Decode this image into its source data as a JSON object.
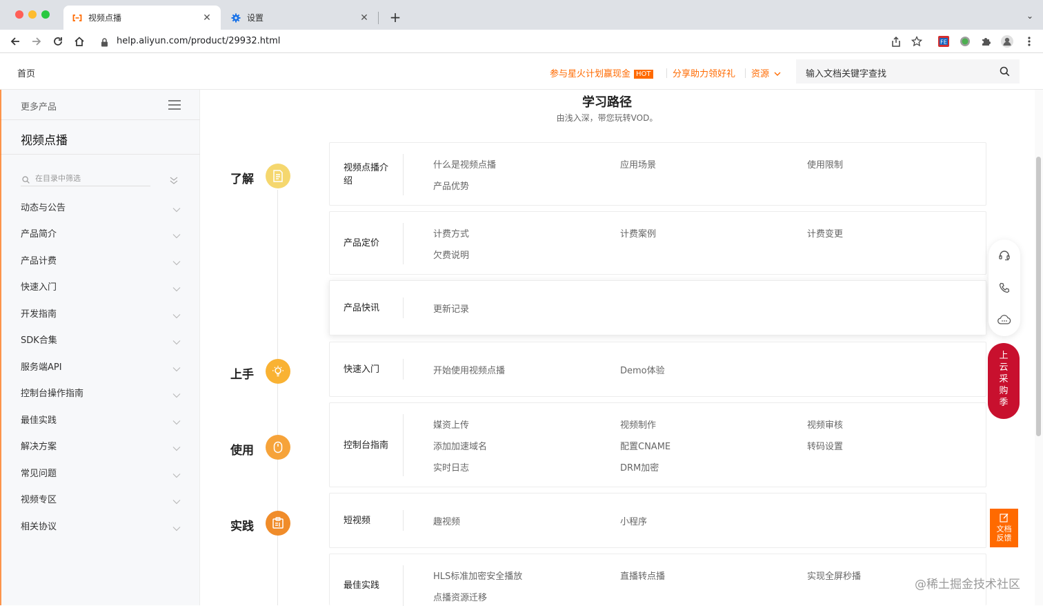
{
  "browser": {
    "tabs": [
      {
        "title": "视频点播",
        "icon": "aliyun-logo-icon",
        "active": true
      },
      {
        "title": "设置",
        "icon": "gear-icon",
        "active": false
      }
    ],
    "url": "help.aliyun.com/product/29932.html",
    "new_tab_symbol": "+",
    "tab_close_symbol": "✕",
    "tab_menu_symbol": "⌄"
  },
  "header": {
    "home_label": "首页",
    "promo1": "参与星火计划赢现金",
    "promo1_badge": "HOT",
    "promo2": "分享助力领好礼",
    "resources_label": "资源",
    "search_placeholder": "输入文档关键字查找"
  },
  "sidebar": {
    "more_products": "更多产品",
    "product_title": "视频点播",
    "filter_placeholder": "在目录中筛选",
    "items": [
      {
        "label": "动态与公告"
      },
      {
        "label": "产品简介"
      },
      {
        "label": "产品计费"
      },
      {
        "label": "快速入门"
      },
      {
        "label": "开发指南"
      },
      {
        "label": "SDK合集"
      },
      {
        "label": "服务端API"
      },
      {
        "label": "控制台操作指南"
      },
      {
        "label": "最佳实践"
      },
      {
        "label": "解决方案"
      },
      {
        "label": "常见问题"
      },
      {
        "label": "视频专区"
      },
      {
        "label": "相关协议"
      }
    ]
  },
  "main": {
    "title": "学习路径",
    "subtitle": "由浅入深，带您玩转VOD。",
    "stages": [
      {
        "label": "了解",
        "icon": "document-icon",
        "color": "#f5d76e"
      },
      {
        "label": "上手",
        "icon": "lightbulb-icon",
        "color": "#f9b233"
      },
      {
        "label": "使用",
        "icon": "mouse-icon",
        "color": "#f6a33a"
      },
      {
        "label": "实践",
        "icon": "clipboard-icon",
        "color": "#f08c2a"
      }
    ],
    "cards": [
      {
        "category": "视频点播介绍",
        "links": [
          "什么是视频点播",
          "应用场景",
          "使用限制",
          "产品优势"
        ]
      },
      {
        "category": "产品定价",
        "links": [
          "计费方式",
          "计费案例",
          "计费变更",
          "欠费说明"
        ]
      },
      {
        "category": "产品快讯",
        "links": [
          "更新记录"
        ]
      },
      {
        "category": "快速入门",
        "links": [
          "开始使用视频点播",
          "Demo体验"
        ]
      },
      {
        "category": "控制台指南",
        "links": [
          "媒资上传",
          "视频制作",
          "视频审核",
          "添加加速域名",
          "配置CNAME",
          "转码设置",
          "实时日志",
          "DRM加密"
        ]
      },
      {
        "category": "短视频",
        "links": [
          "趣视频",
          "小程序"
        ]
      },
      {
        "category": "最佳实践",
        "links": [
          "HLS标准加密安全播放",
          "直播转点播",
          "实现全屏秒播",
          "点播资源迁移"
        ]
      }
    ]
  },
  "floating": {
    "icons": [
      "headset-icon",
      "phone-icon",
      "chat-cloud-icon"
    ],
    "purchase_chars": [
      "上",
      "云",
      "采",
      "购",
      "季"
    ],
    "feedback_line1": "文档",
    "feedback_line2": "反馈"
  },
  "watermark": "@稀土掘金技术社区",
  "colors": {
    "accent": "#ff6a00",
    "purchase": "#c8102e"
  }
}
